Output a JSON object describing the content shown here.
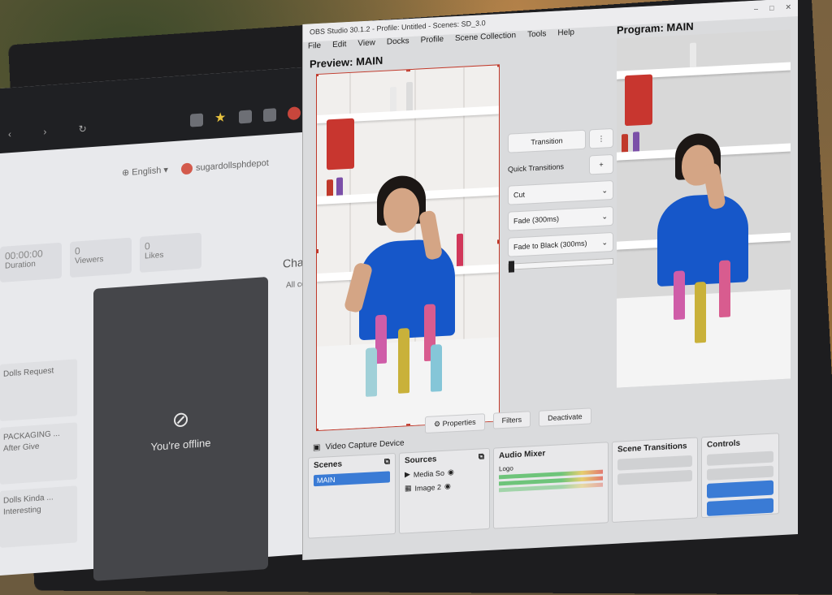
{
  "browser": {
    "language": "English",
    "username": "sugardollsphdepot",
    "stats": [
      {
        "value": "00:00:00",
        "label": "Duration"
      },
      {
        "value": "0",
        "label": "Viewers"
      },
      {
        "value": "0",
        "label": "Likes"
      }
    ],
    "video_status": "You're offline",
    "chat_label": "Chat",
    "chat_tab": "All co",
    "left_items": [
      "Dolls Request",
      "PACKAGING ... After Give",
      "Dolls Kinda ... Interesting"
    ]
  },
  "obs": {
    "title": "OBS Studio 30.1.2 - Profile: Untitled - Scenes: SD_3.0",
    "menu": [
      "File",
      "Edit",
      "View",
      "Docks",
      "Profile",
      "Scene Collection",
      "Tools",
      "Help"
    ],
    "preview_label": "Preview: MAIN",
    "program_label": "Program: MAIN",
    "transition_button": "Transition",
    "quick_transitions_label": "Quick Transitions",
    "transitions": [
      "Cut",
      "Fade (300ms)",
      "Fade to Black (300ms)"
    ],
    "bottom_buttons": [
      "Properties",
      "Filters",
      "Deactivate"
    ],
    "source_name": "Video Capture Device",
    "docks": {
      "scenes_title": "Scenes",
      "scene_selected": "MAIN",
      "sources_title": "Sources",
      "sources": [
        "Media So",
        "Image 2"
      ],
      "audio_title": "Audio Mixer",
      "audio_channel": "Logo",
      "scene_transitions_title": "Scene Transitions",
      "controls_title": "Controls"
    }
  },
  "colors": {
    "selection_red": "#c0392b",
    "shirt_blue": "#1657c9",
    "obs_accent": "#3a7bd5"
  }
}
